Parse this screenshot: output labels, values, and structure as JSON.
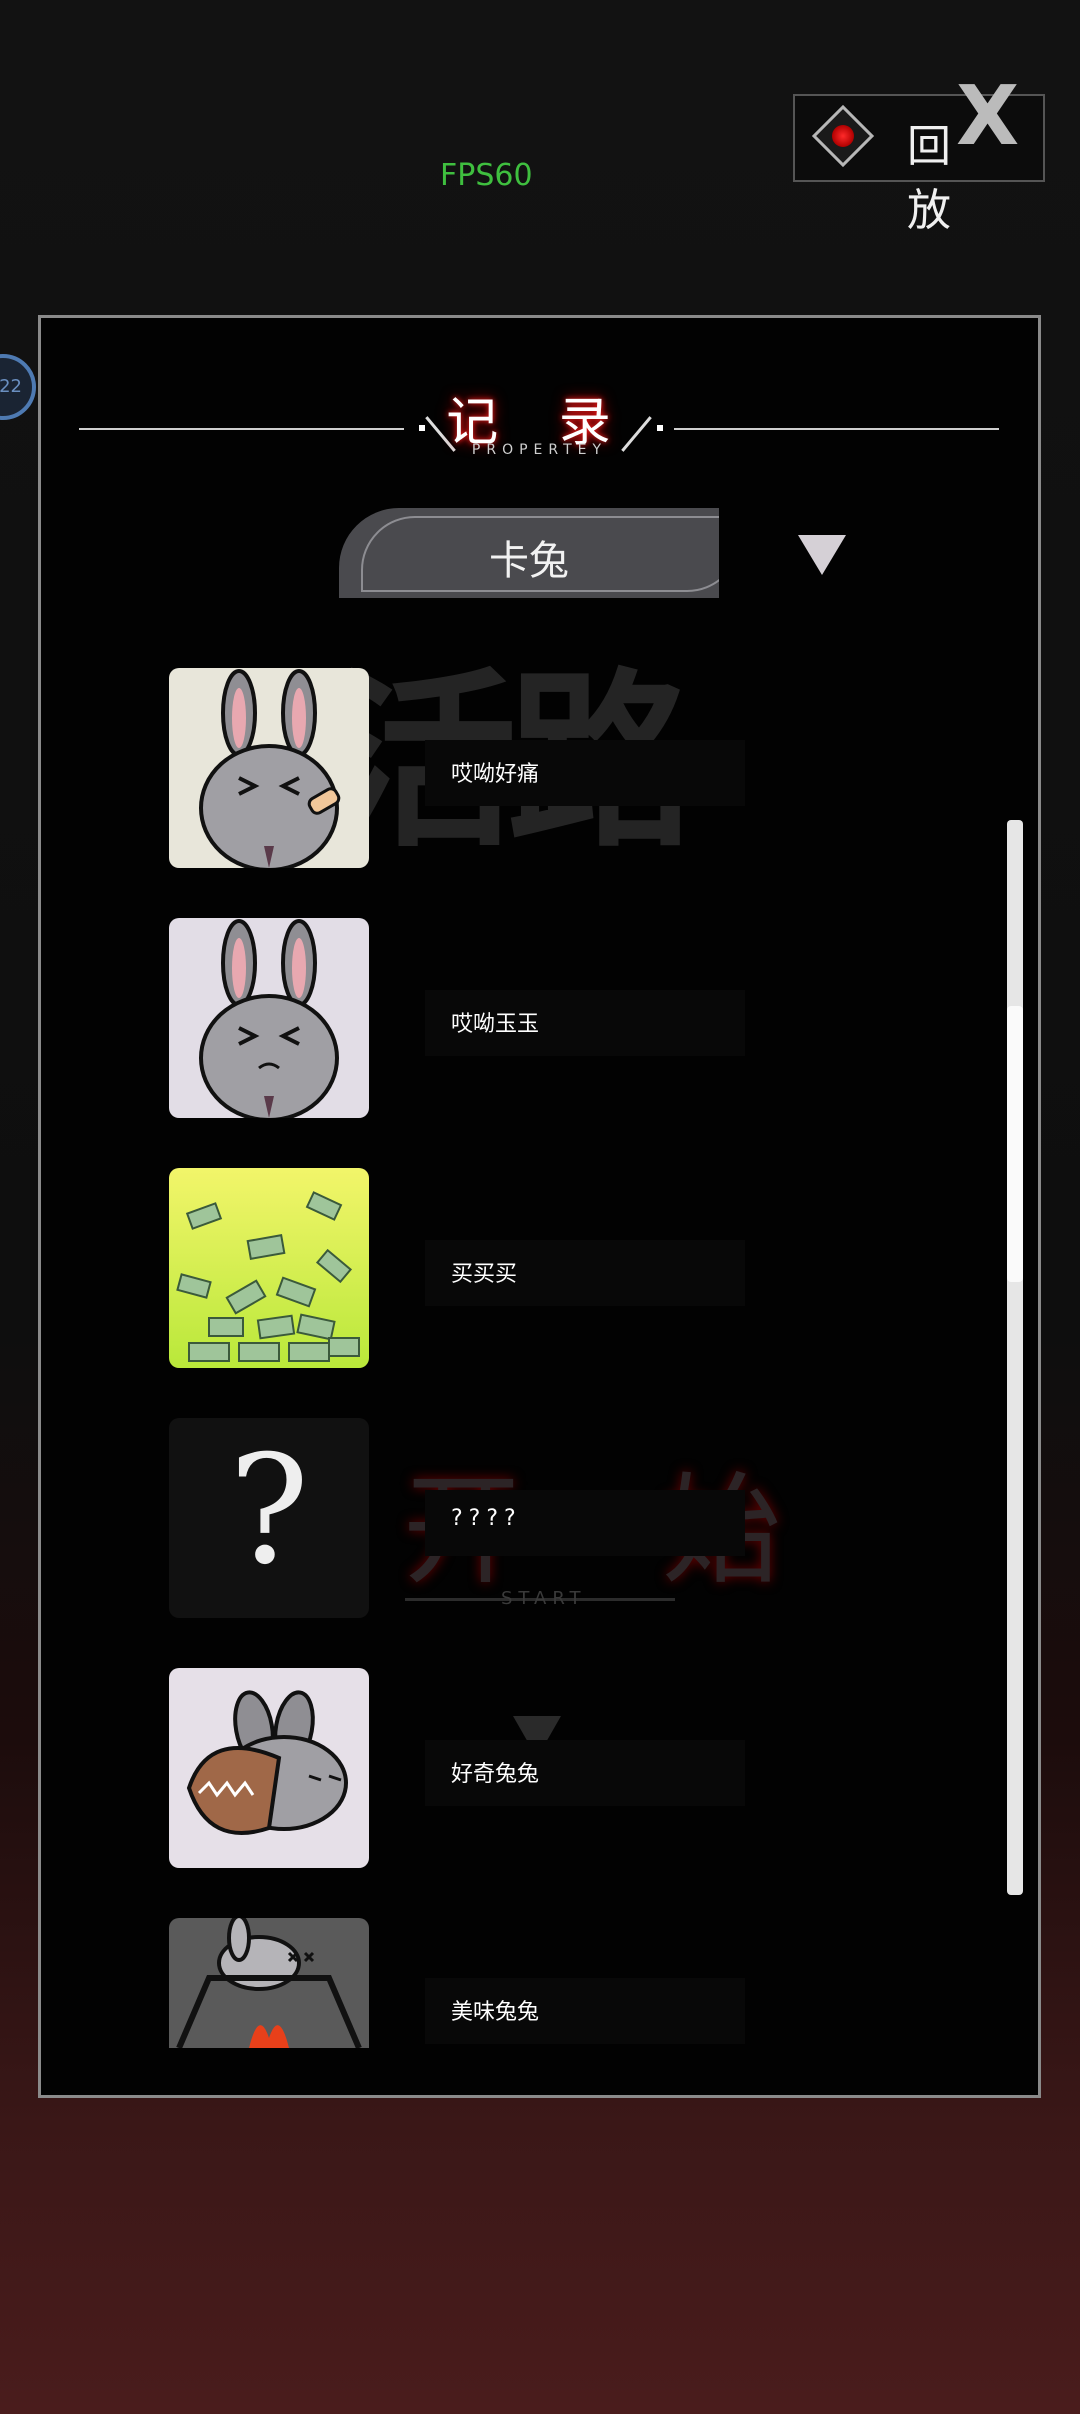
{
  "hud": {
    "fps": "FPS60",
    "replay_label": "回 放"
  },
  "panel": {
    "title": "记 录",
    "subtitle": "PROPERTEY",
    "character": "卡兔",
    "ghost_title": "活路",
    "ghost_start": "开 始",
    "ghost_start_sub": "START"
  },
  "records": [
    {
      "name": "哎呦好痛",
      "image": "bunny-hurt",
      "thumb_bg": "#e8e6da"
    },
    {
      "name": "哎呦玉玉",
      "image": "bunny-sad",
      "thumb_bg": "#e2dde6"
    },
    {
      "name": "买买买",
      "image": "money-pile",
      "thumb_bg": "#c8ee3c"
    },
    {
      "name": "????",
      "image": "question-mark",
      "thumb_bg": "#111111"
    },
    {
      "name": "好奇兔兔",
      "image": "bunny-trap",
      "thumb_bg": "#e6e0e8"
    },
    {
      "name": "美味兔兔",
      "image": "bunny-grill",
      "thumb_bg": "#5a5a5a"
    }
  ],
  "colors": {
    "accent_red": "#ff2020",
    "fps_green": "#3fbf3f"
  }
}
